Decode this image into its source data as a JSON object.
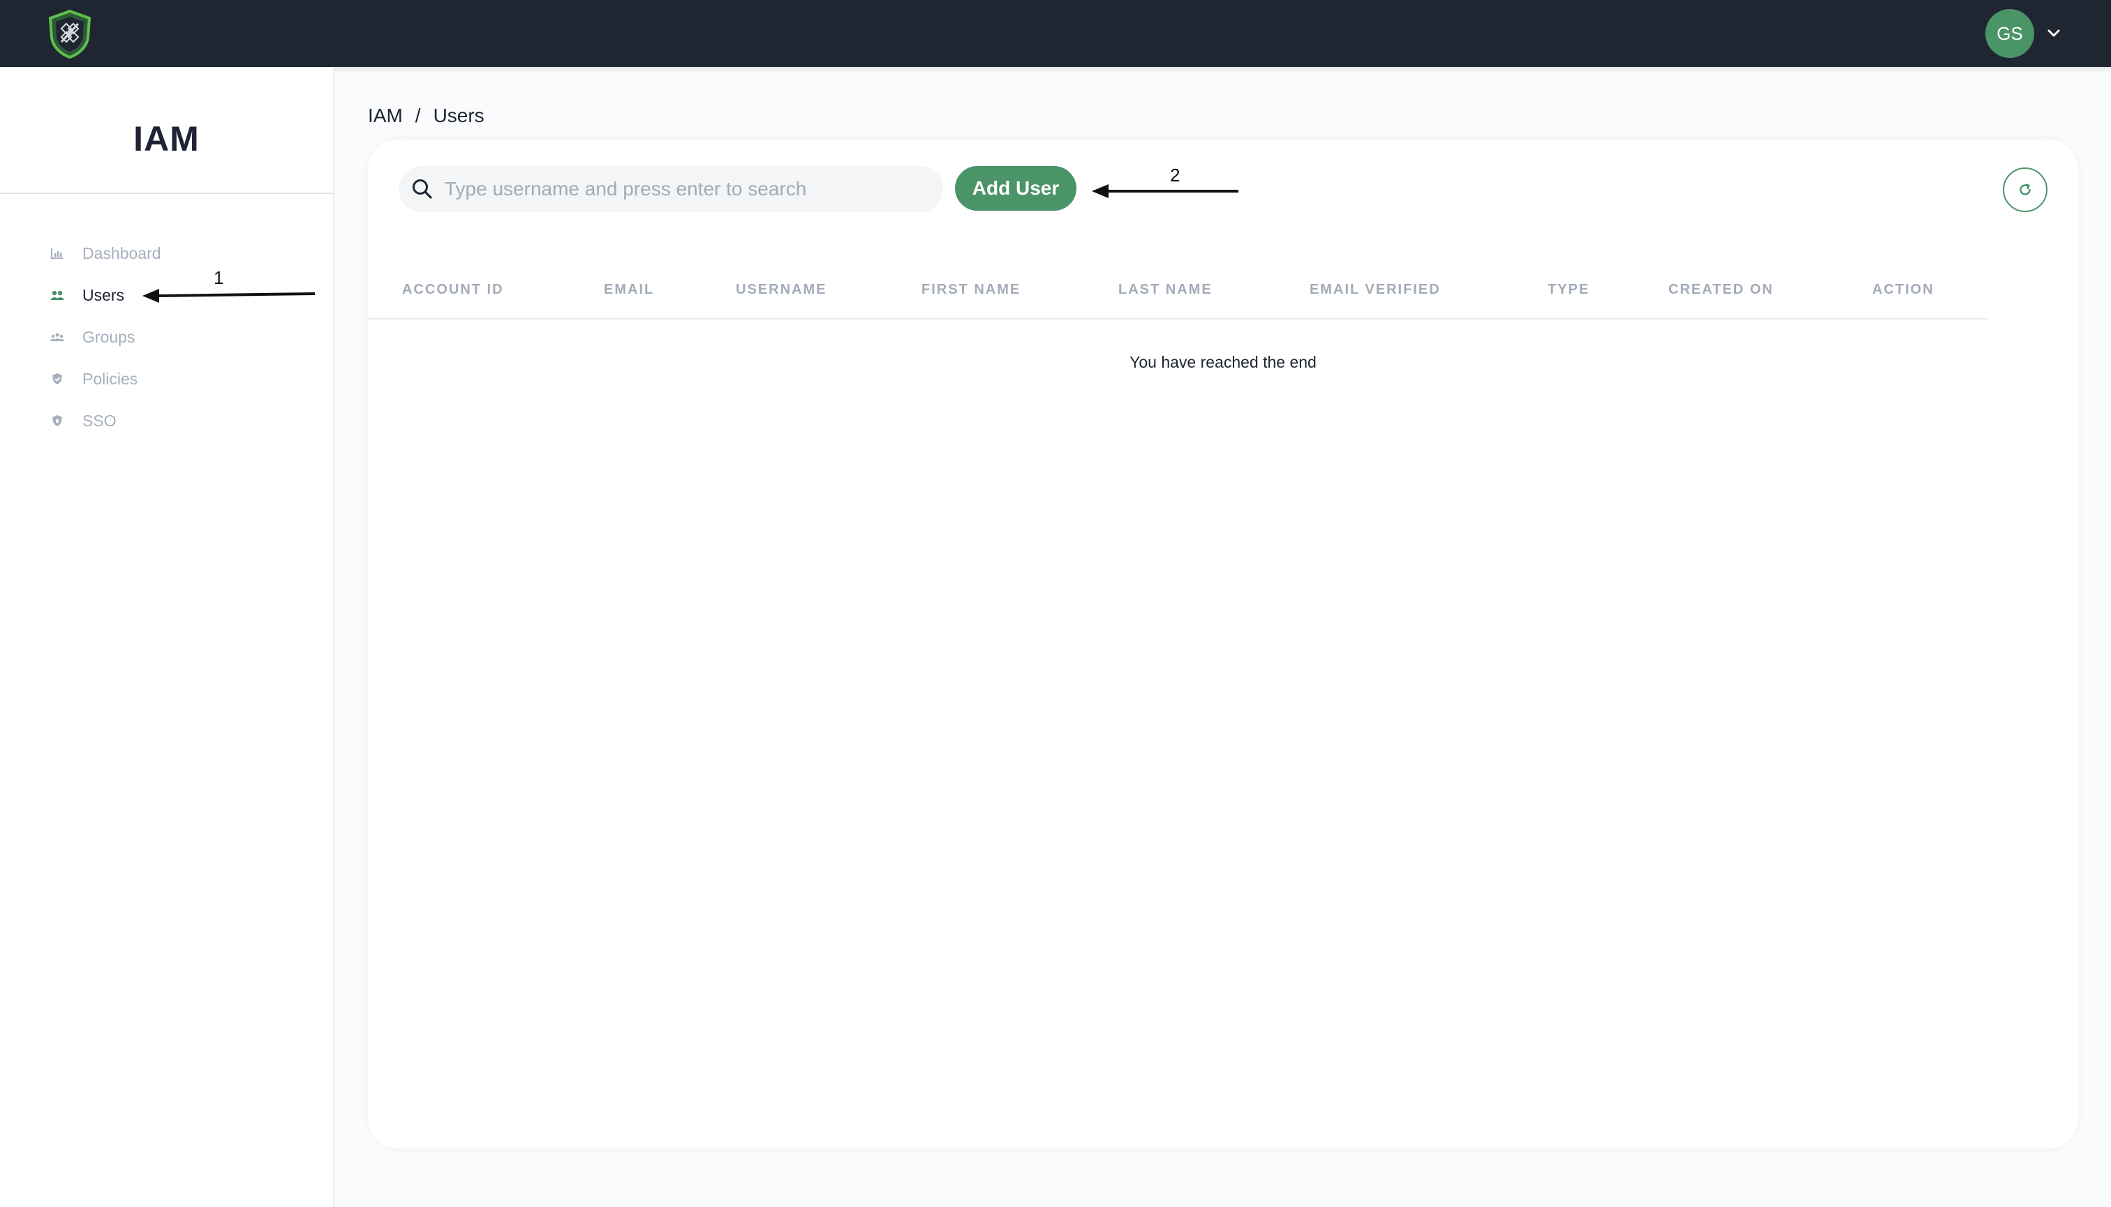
{
  "header": {
    "logo_icon": "shield-logo-icon",
    "avatar_initials": "GS",
    "accent_color": "#4a9468",
    "bar_color": "#1f2631"
  },
  "sidebar": {
    "title": "IAM",
    "items": [
      {
        "label": "Dashboard",
        "icon": "chart-icon",
        "active": false
      },
      {
        "label": "Users",
        "icon": "users-icon",
        "active": true
      },
      {
        "label": "Groups",
        "icon": "groups-icon",
        "active": false
      },
      {
        "label": "Policies",
        "icon": "shield-icon",
        "active": false
      },
      {
        "label": "SSO",
        "icon": "shield-icon",
        "active": false
      }
    ]
  },
  "breadcrumb": {
    "root": "IAM",
    "separator": "/",
    "current": "Users"
  },
  "toolbar": {
    "search_placeholder": "Type username and press enter to search",
    "add_user_label": "Add User",
    "refresh_icon": "refresh-icon"
  },
  "table": {
    "columns": [
      "ACCOUNT ID",
      "EMAIL",
      "USERNAME",
      "FIRST NAME",
      "LAST NAME",
      "EMAIL VERIFIED",
      "TYPE",
      "CREATED ON",
      "ACTION"
    ],
    "rows": [],
    "end_message": "You have reached the end"
  },
  "annotations": {
    "arrow_1_label": "1",
    "arrow_2_label": "2"
  }
}
